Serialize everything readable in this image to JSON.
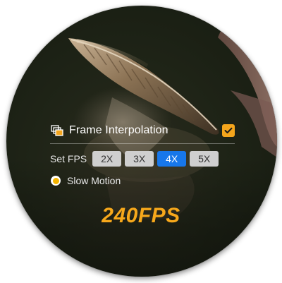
{
  "overlay": {
    "frame_interpolation": {
      "label": "Frame Interpolation",
      "icon": "layered-frames-icon",
      "checked": true
    },
    "set_fps": {
      "label": "Set FPS",
      "options": [
        "2X",
        "3X",
        "4X",
        "5X"
      ],
      "selected": "4X"
    },
    "slow_motion": {
      "label": "Slow Motion",
      "selected": true
    },
    "fps_readout": "240FPS"
  },
  "colors": {
    "accent_orange": "#f4a51c",
    "selected_blue": "#1777ea",
    "button_gray": "#cfcfcf",
    "readout_orange": "#f7a81b"
  }
}
